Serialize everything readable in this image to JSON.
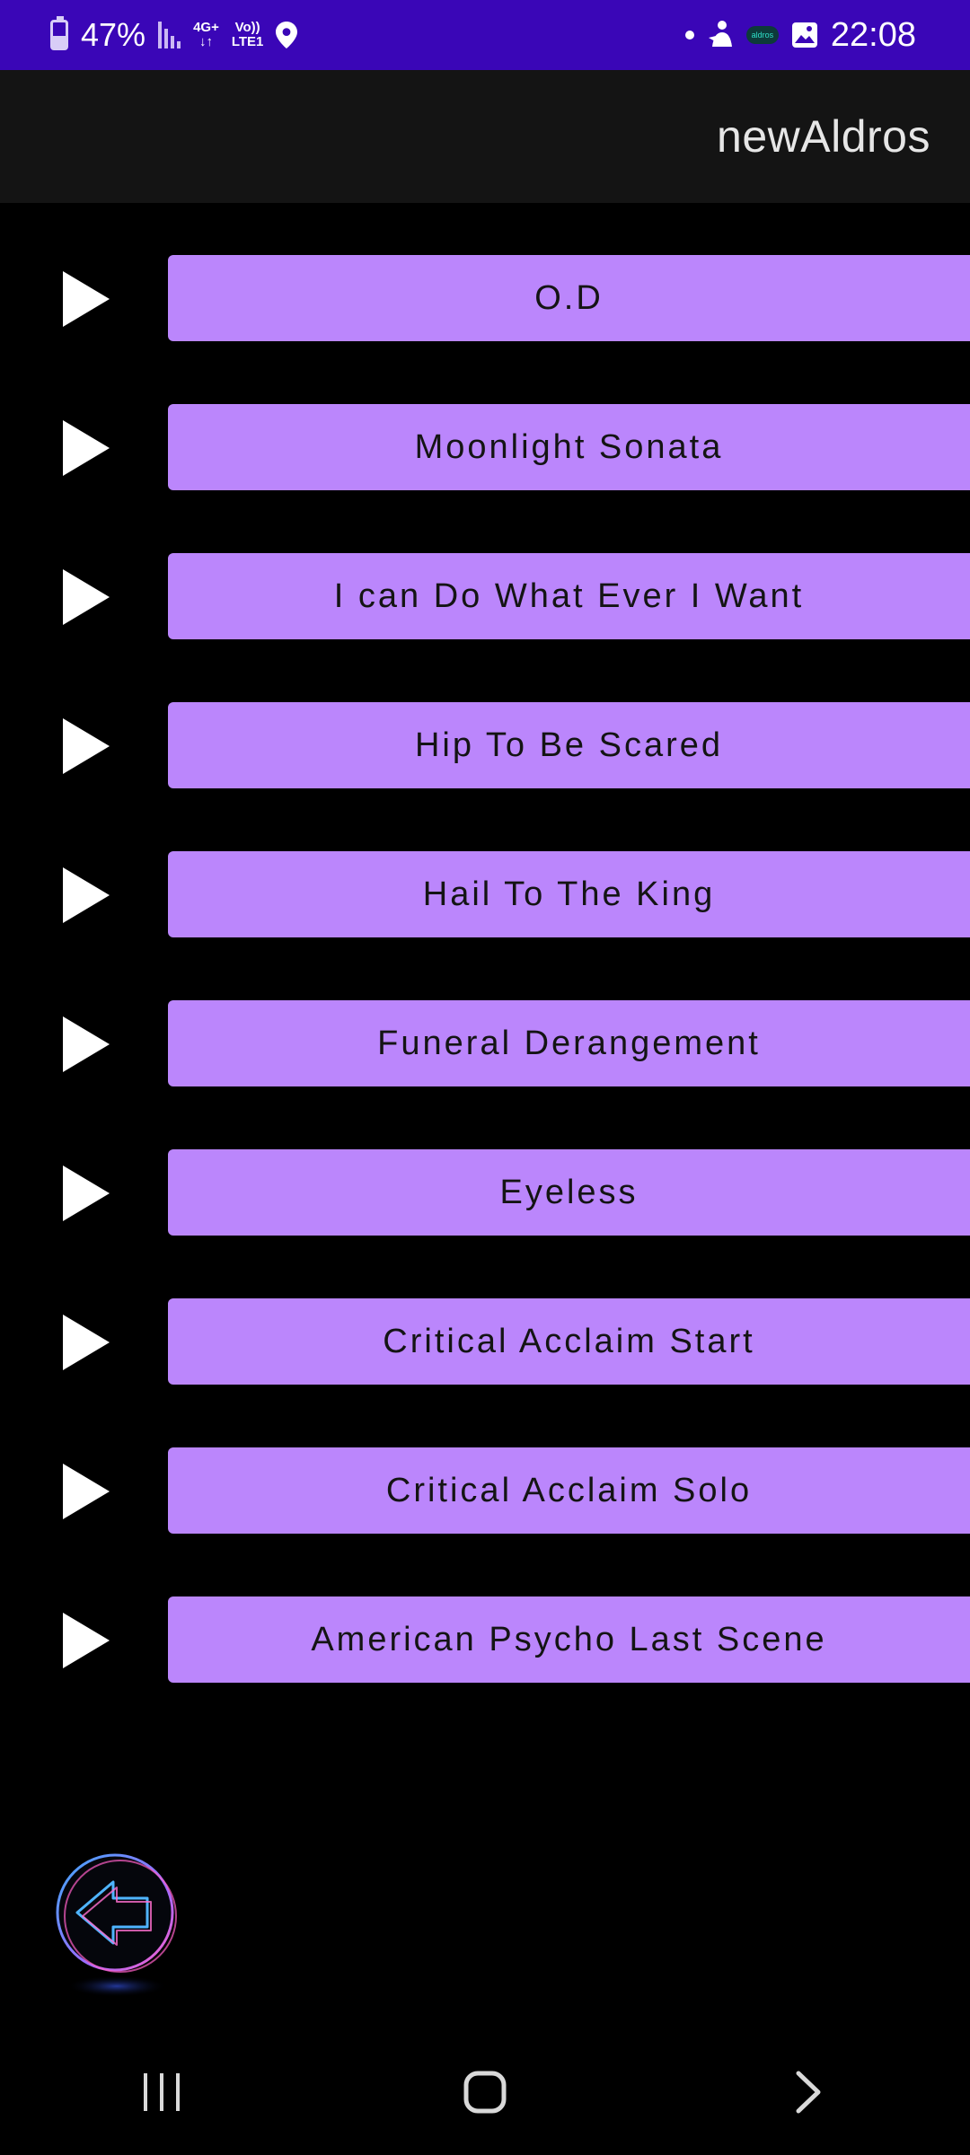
{
  "status_bar": {
    "battery": "47%",
    "network_top": "4G+",
    "network_bottom_left": "Vo))",
    "network_bottom_right": "LTE1",
    "app_mini_label": "aldros",
    "time": "22:08"
  },
  "app_bar": {
    "title": "newAldros"
  },
  "tracks": [
    {
      "label": "O.D"
    },
    {
      "label": "Moonlight Sonata"
    },
    {
      "label": "I can Do What Ever I Want"
    },
    {
      "label": "Hip To Be Scared"
    },
    {
      "label": "Hail To The King"
    },
    {
      "label": "Funeral Derangement"
    },
    {
      "label": "Eyeless"
    },
    {
      "label": "Critical Acclaim Start"
    },
    {
      "label": "Critical Acclaim Solo"
    },
    {
      "label": "American Psycho Last Scene"
    }
  ],
  "icons": {
    "play": "play-icon",
    "back": "back-arrow-icon",
    "recents": "recents-icon",
    "home": "home-icon",
    "forward": "chevron-right-icon"
  },
  "colors": {
    "status_bar": "#3a06b7",
    "app_bar": "#141414",
    "track_button": "#bb86fc",
    "background": "#000000"
  }
}
